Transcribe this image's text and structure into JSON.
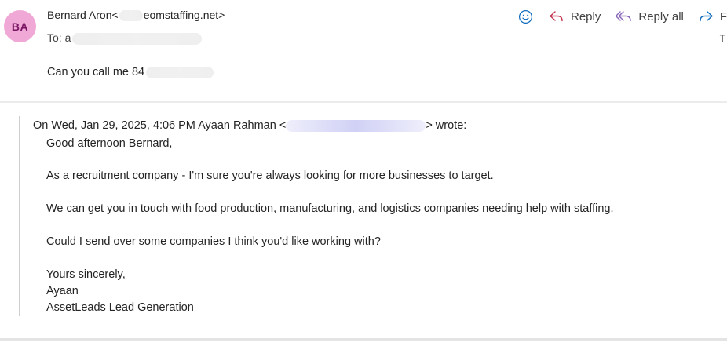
{
  "header": {
    "avatar_initials": "BA",
    "from_name": "Bernard Aron",
    "from_open": "<",
    "from_email_visible": "eomstaffing.net>",
    "to_label": "To:",
    "to_visible": "a",
    "date_stub": "T"
  },
  "actions": {
    "emoji_icon": "smiley-icon",
    "reply_label": "Reply",
    "reply_all_label": "Reply all",
    "forward_label": "F"
  },
  "message": {
    "text_visible": "Can you call me 84"
  },
  "quoted": {
    "attribution_prefix": "On Wed, Jan 29, 2025, 4:06 PM Ayaan Rahman <",
    "attribution_suffix": "> wrote:",
    "greeting": "Good afternoon Bernard,",
    "para1": "As a recruitment company - I'm sure you're always looking for more businesses to target.",
    "para2": "We can get you in touch with food production, manufacturing, and logistics companies needing help with staffing.",
    "para3": "Could I send over some companies I think you'd like working with?",
    "signoff": "Yours sincerely,",
    "sig_name": "Ayaan",
    "sig_company": "AssetLeads Lead Generation"
  },
  "colors": {
    "avatar_bg": "#f0a8d6",
    "avatar_text": "#7a1664",
    "accent_icon": "#0f6cbd",
    "reply_all_icon": "#8764b8"
  }
}
